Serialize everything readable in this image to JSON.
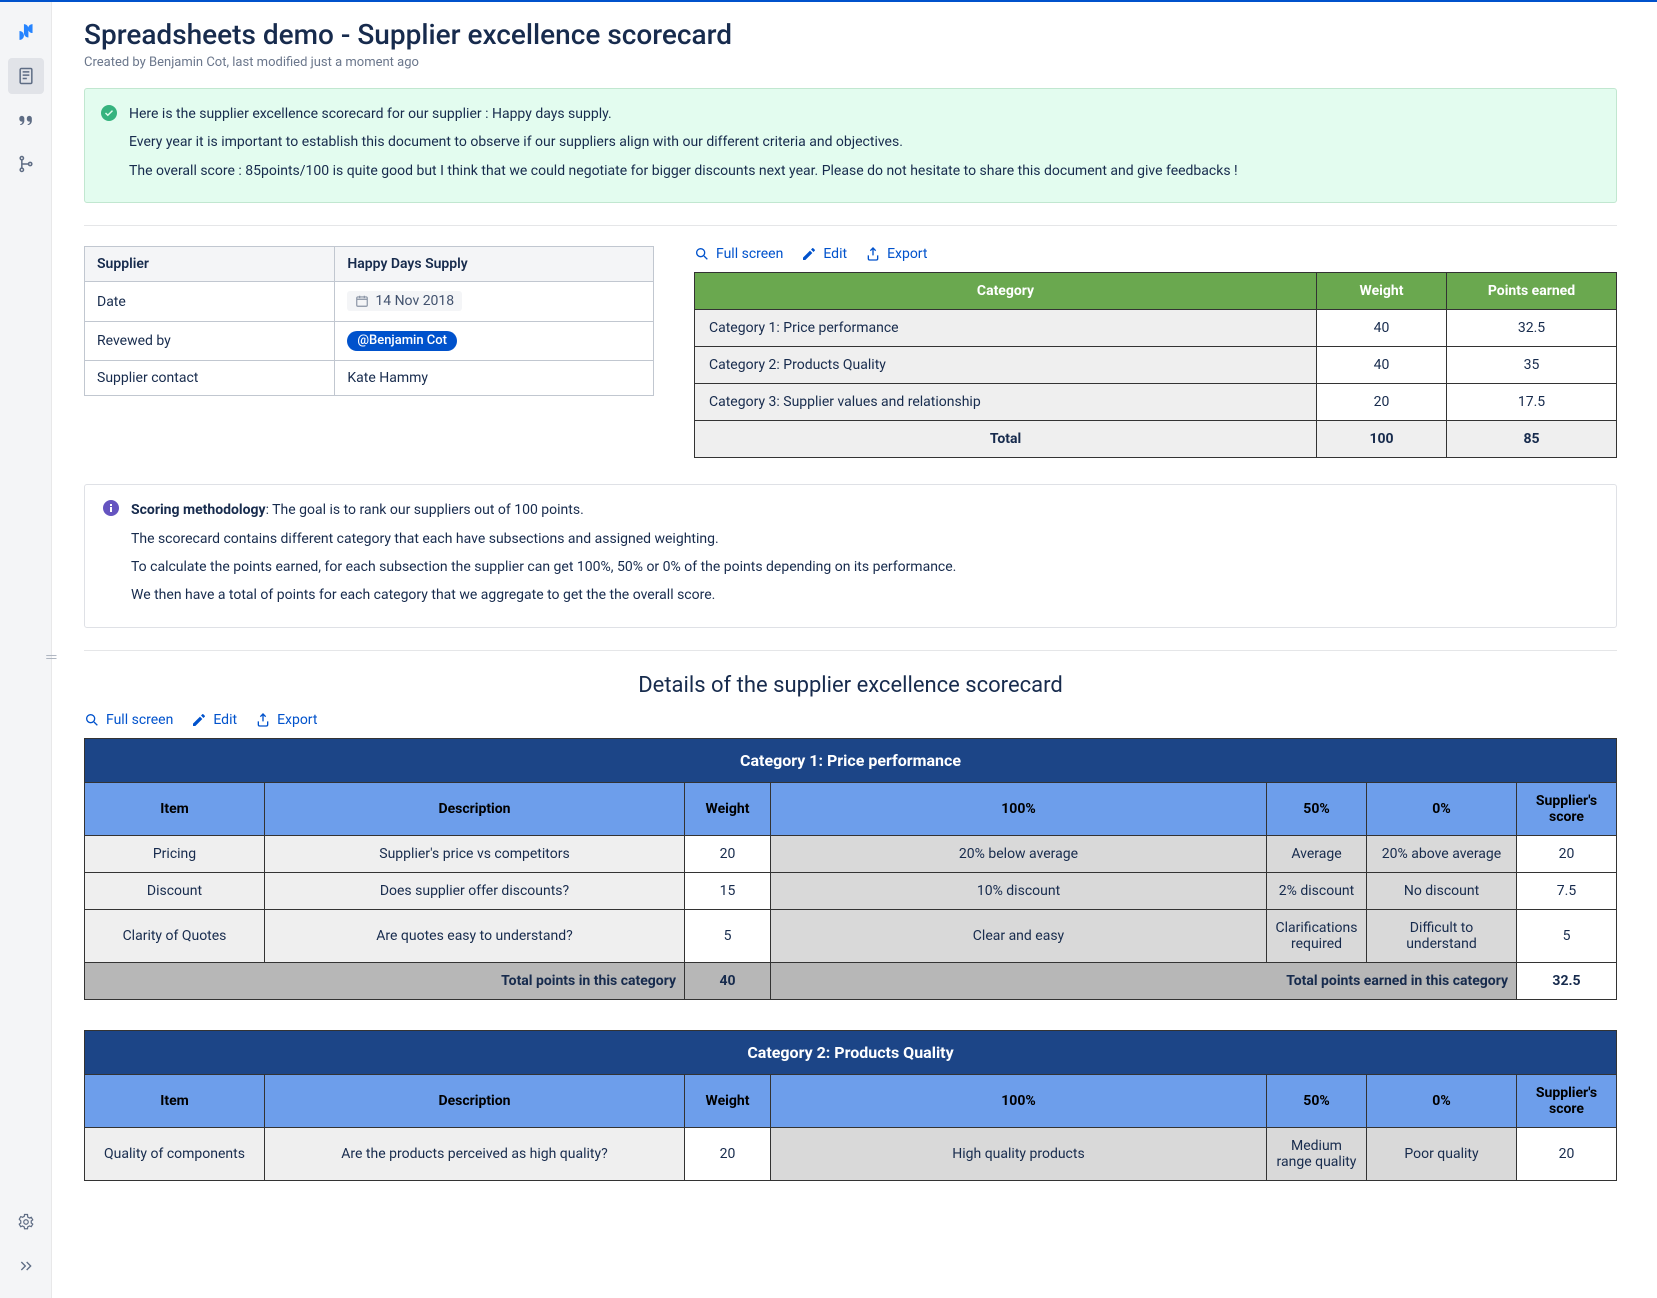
{
  "page": {
    "title": "Spreadsheets demo - Supplier excellence scorecard",
    "meta": "Created by Benjamin Cot, last modified just a moment ago",
    "details_heading": "Details of the supplier excellence scorecard"
  },
  "intro_panel": {
    "lines": [
      "Here is the supplier excellence scorecard for our supplier : Happy days supply.",
      "Every year it is important to establish this document to observe if our suppliers align with our different criteria and objectives.",
      "The overall score : 85points/100 is quite good but I think that we could negotiate for bigger discounts next year. Please do not hesitate to share this document and give feedbacks !"
    ]
  },
  "meta_table": {
    "header_k": "Supplier",
    "header_v": "Happy Days Supply",
    "rows": [
      {
        "k": "Date",
        "v": "14 Nov 2018",
        "type": "date"
      },
      {
        "k": "Revewed by",
        "v": "@Benjamin Cot",
        "type": "mention"
      },
      {
        "k": "Supplier contact",
        "v": "Kate Hammy",
        "type": "text"
      }
    ]
  },
  "toolbar": {
    "fullscreen": "Full screen",
    "edit": "Edit",
    "export": "Export"
  },
  "summary": {
    "headers": [
      "Category",
      "Weight",
      "Points earned"
    ],
    "rows": [
      {
        "cat": "Category 1: Price performance",
        "weight": "40",
        "points": "32.5"
      },
      {
        "cat": "Category 2: Products Quality",
        "weight": "40",
        "points": "35"
      },
      {
        "cat": "Category 3: Supplier values and relationship",
        "weight": "20",
        "points": "17.5"
      }
    ],
    "total_label": "Total",
    "total_weight": "100",
    "total_points": "85"
  },
  "methodology": {
    "lead_label": "Scoring methodology",
    "lead_rest": ": The goal is to rank our suppliers out of 100 points.",
    "lines": [
      "The scorecard contains different category that each have subsections and assigned weighting.",
      "To calculate the points earned, for each subsection the supplier can get 100%, 50% or 0% of the points depending on its performance.",
      "We then have a total of points for each category that we aggregate to get the the overall score."
    ]
  },
  "details_headers": {
    "item": "Item",
    "desc": "Description",
    "weight": "Weight",
    "p100": "100%",
    "p50": "50%",
    "p0": "0%",
    "score": "Supplier's score",
    "total_label": "Total points in this category",
    "earned_label": "Total points earned in this category"
  },
  "cat1": {
    "title": "Category 1: Price performance",
    "rows": [
      {
        "item": "Pricing",
        "desc": "Supplier's price vs competitors",
        "weight": "20",
        "p100": "20% below average",
        "p50": "Average",
        "p0": "20% above average",
        "score": "20"
      },
      {
        "item": "Discount",
        "desc": "Does supplier offer discounts?",
        "weight": "15",
        "p100": "10% discount",
        "p50": "2% discount",
        "p0": "No discount",
        "score": "7.5"
      },
      {
        "item": "Clarity of Quotes",
        "desc": "Are quotes easy to understand?",
        "weight": "5",
        "p100": "Clear and easy",
        "p50": "Clarifications required",
        "p0": "Difficult to understand",
        "score": "5"
      }
    ],
    "total_weight": "40",
    "total_score": "32.5"
  },
  "cat2": {
    "title": "Category 2: Products Quality",
    "rows": [
      {
        "item": "Quality of components",
        "desc": "Are the products perceived as high quality?",
        "weight": "20",
        "p100": "High quality products",
        "p50": "Medium range quality",
        "p0": "Poor quality",
        "score": "20"
      }
    ]
  }
}
